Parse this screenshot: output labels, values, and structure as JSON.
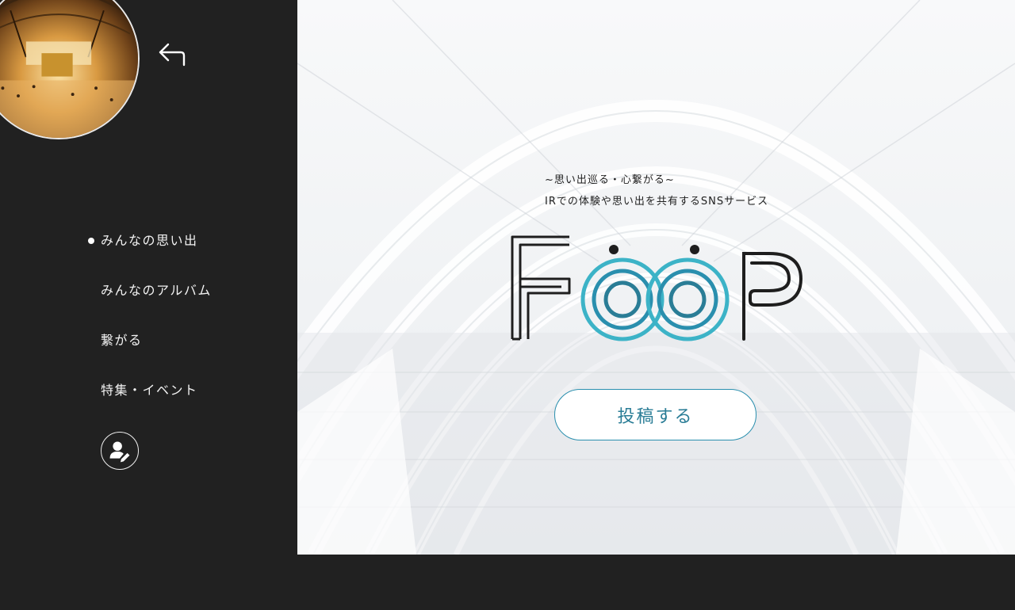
{
  "sidebar": {
    "nav_items": [
      {
        "label": "みんなの思い出",
        "active": true
      },
      {
        "label": "みんなのアルバム",
        "active": false
      },
      {
        "label": "繋がる",
        "active": false
      },
      {
        "label": "特集・イベント",
        "active": false
      }
    ],
    "icons": {
      "back": "back-arrow-icon",
      "profile": "user-edit-icon",
      "avatar": "avatar-photo"
    }
  },
  "hero": {
    "tagline_line1": "~思い出巡る・心繋がる~",
    "tagline_line2": "IRでの体験や思い出を共有するSNSサービス",
    "logo_text": "FOOP",
    "post_button_label": "投稿する"
  },
  "colors": {
    "sidebar_bg": "#212121",
    "accent_teal": "#2a8fae",
    "accent_light_teal": "#3eb2c6"
  }
}
